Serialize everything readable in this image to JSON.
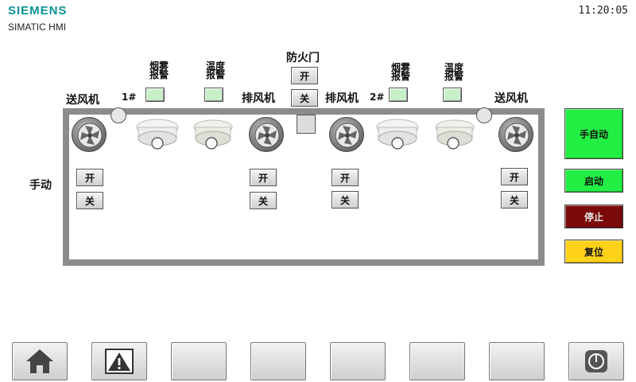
{
  "header": {
    "brand": "SIEMENS",
    "product": "SIMATIC HMI",
    "time": "11:20:05"
  },
  "labels": {
    "supply_fan_left": "送风机",
    "supply_fan_right": "送风机",
    "exhaust_fan_1": "排风机",
    "exhaust_fan_2": "排风机",
    "unit1": "1#",
    "unit2": "2#",
    "fire_door": "防火门",
    "manual": "手动",
    "smoke_alarm_l1": "烟雾",
    "smoke_alarm_l2": "报警",
    "temp_alarm_l1": "温度",
    "temp_alarm_l2": "报警"
  },
  "door_buttons": {
    "open": "开",
    "close": "关"
  },
  "fan_buttons": {
    "open": "开",
    "close": "关"
  },
  "side_buttons": {
    "auto_manual": "手自动",
    "start": "启动",
    "stop": "停止",
    "reset": "复位"
  },
  "colors": {
    "auto_manual": "#22ee44",
    "start": "#22ee44",
    "stop": "#7a0a0a",
    "reset": "#ffd21a",
    "indicator": "#c8f0c8",
    "frame": "#8c8c8c",
    "brand": "#0a9396"
  },
  "function_keys": [
    {
      "icon": "home-icon"
    },
    {
      "icon": "alarm-warning-icon"
    },
    {
      "icon": ""
    },
    {
      "icon": ""
    },
    {
      "icon": ""
    },
    {
      "icon": ""
    },
    {
      "icon": ""
    },
    {
      "icon": "power-icon"
    }
  ]
}
